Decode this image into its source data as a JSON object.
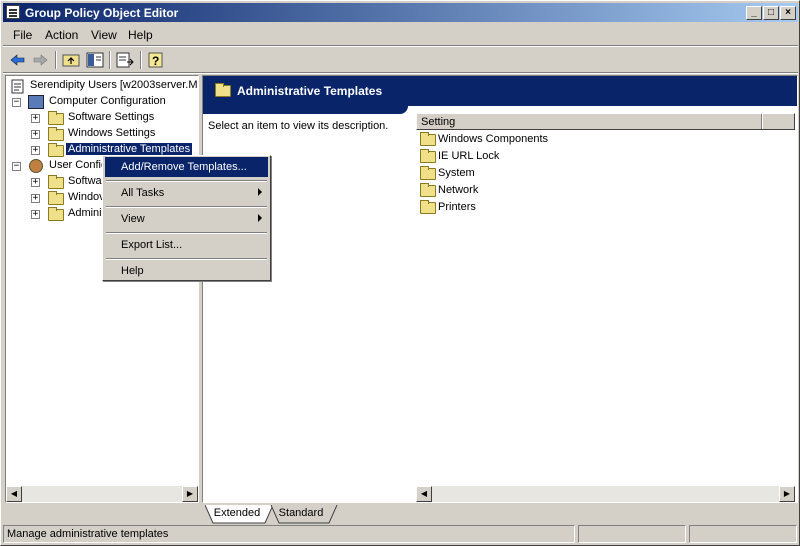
{
  "window": {
    "title": "Group Policy Object Editor"
  },
  "menubar": [
    "File",
    "Action",
    "View",
    "Help"
  ],
  "tree": {
    "root": "Serendipity Users [w2003server.M",
    "computer_config": "Computer Configuration",
    "computer_children": [
      "Software Settings",
      "Windows Settings",
      "Administrative Templates"
    ],
    "user_config": "User Confic",
    "user_children": [
      "Softwa",
      "Windov",
      "Adminis"
    ]
  },
  "context_menu": {
    "items": [
      "Add/Remove Templates...",
      "All Tasks",
      "View",
      "Export List...",
      "Help"
    ]
  },
  "right_pane": {
    "header": "Administrative Templates",
    "description": "Select an item to view its description.",
    "column_header": "Setting",
    "items": [
      "Windows Components",
      "IE URL Lock",
      "System",
      "Network",
      "Printers"
    ]
  },
  "tabs": [
    "Extended",
    "Standard"
  ],
  "statusbar": {
    "text": "Manage administrative templates"
  },
  "colors": {
    "selection": "#0a246a",
    "face": "#d4d0c8"
  }
}
